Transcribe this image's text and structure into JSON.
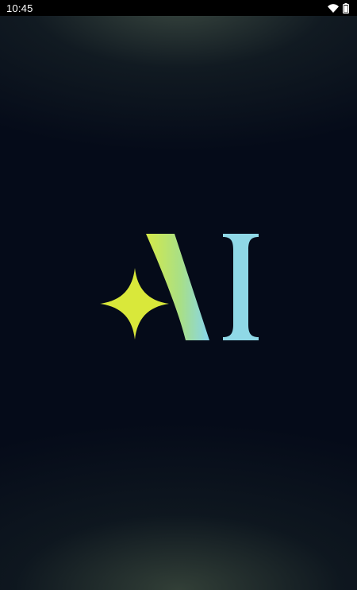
{
  "status_bar": {
    "time": "10:45",
    "icons": [
      "wifi-icon",
      "battery-icon"
    ]
  },
  "splash": {
    "logo": {
      "text": "AI",
      "icon": "sparkle-star-icon",
      "colors": {
        "star": "#d9e83a",
        "gradient_start": "#d5e947",
        "gradient_end": "#86d4ee"
      }
    },
    "background": {
      "base": "#050b19",
      "glow": "#5c6e55"
    }
  }
}
